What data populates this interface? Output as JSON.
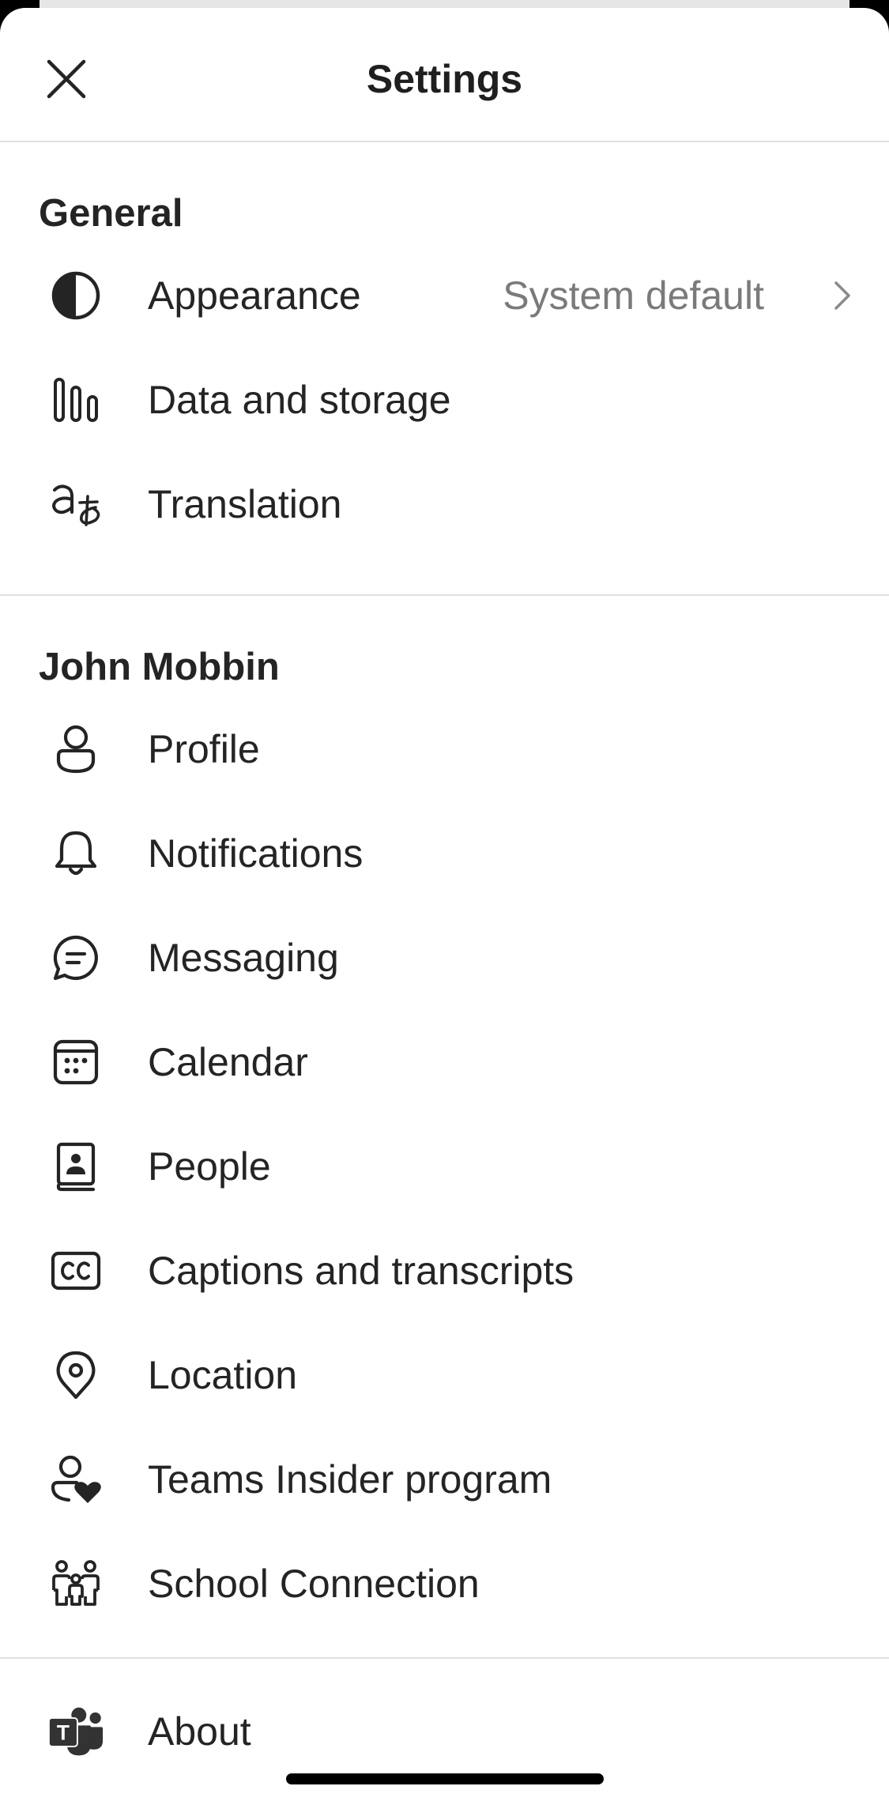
{
  "header": {
    "title": "Settings",
    "close_icon": "close-icon"
  },
  "general": {
    "heading": "General",
    "items": [
      {
        "label": "Appearance",
        "value": "System default",
        "icon": "appearance-icon"
      },
      {
        "label": "Data and storage",
        "icon": "data-storage-icon"
      },
      {
        "label": "Translation",
        "icon": "translation-icon"
      }
    ]
  },
  "account": {
    "heading": "John Mobbin",
    "items": [
      {
        "label": "Profile",
        "icon": "profile-icon"
      },
      {
        "label": "Notifications",
        "icon": "bell-icon"
      },
      {
        "label": "Messaging",
        "icon": "chat-icon"
      },
      {
        "label": "Calendar",
        "icon": "calendar-icon"
      },
      {
        "label": "People",
        "icon": "contact-book-icon"
      },
      {
        "label": "Captions and transcripts",
        "icon": "closed-captions-icon"
      },
      {
        "label": "Location",
        "icon": "location-pin-icon"
      },
      {
        "label": "Teams Insider program",
        "icon": "person-heart-icon"
      },
      {
        "label": "School Connection",
        "icon": "family-icon"
      }
    ]
  },
  "about": {
    "label": "About",
    "icon": "teams-logo-icon",
    "logo_letter": "T"
  },
  "colors": {
    "text": "#242424",
    "secondary_text": "#7a7a7a",
    "divider": "#e0e0e0",
    "teams_logo": "#333333"
  }
}
